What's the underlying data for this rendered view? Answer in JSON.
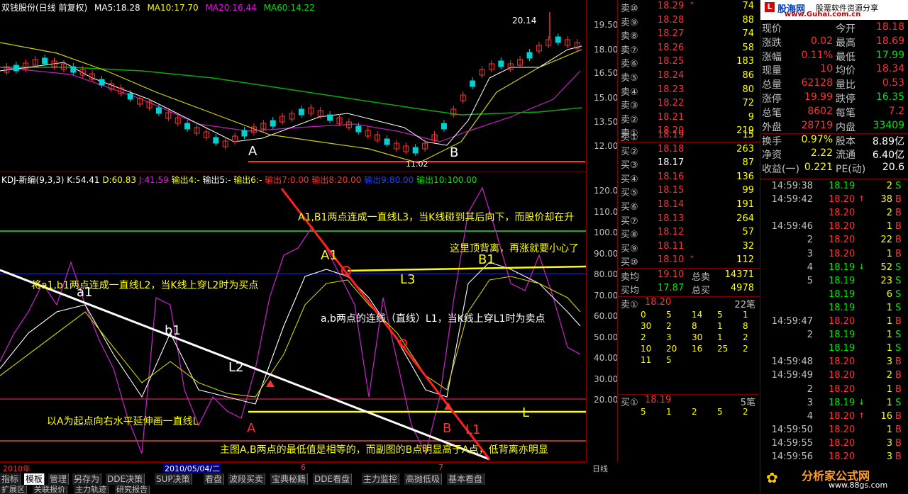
{
  "chart": {
    "header": {
      "title": "双钱股份(日线 前复权)",
      "ma5": "MA5:18.28",
      "ma10": "MA10:17.70",
      "ma20": "MA20:16.44",
      "ma60": "MA60:14.22"
    },
    "price_axis": [
      "19.50",
      "18.00",
      "16.50",
      "15.00",
      "13.50",
      "12.00"
    ],
    "kdj_axis": [
      "120.0",
      "110.0",
      "100.0",
      "90.00",
      "80.00",
      "70.00",
      "60.00",
      "50.00",
      "40.00",
      "30.00",
      "20.00"
    ],
    "peak_label": "20.14",
    "trough_label": "11.02",
    "kdj_header": {
      "name": "KDJ-新编(9,3,3)",
      "k": "K:54.41",
      "d": "D:60.83",
      "j": "J:41.59",
      "out4": "输出4:-",
      "out5": "输出5:-",
      "out6": "输出6:-",
      "out7": "输出7:0.00",
      "out8": "输出8:20.00",
      "out9": "输出9:80.00",
      "out10": "输出10:100.00"
    },
    "annotations": {
      "a1b1_line": "A1,B1两点连成一直线L3，当K线碰到其后向下，而股价却在升",
      "top_divergence": "这里顶背离，再涨就要小心了",
      "l2_buy": "将a1,b1两点连成一直线L2，当K线上穿L2时为买点",
      "l1_sell": "a,b两点的连线（直线）L1，当K线上穿L1时为卖点",
      "horizontal_l": "以A为起点向右水平延伸画一直线L",
      "bottom_note": "主图A,B两点的最低值是相等的，而副图的B点明显高于A点，低背离亦明显"
    },
    "point_labels": {
      "A": "A",
      "B": "B",
      "A1": "A1",
      "B1": "B1",
      "a1": "a1",
      "b1": "b1",
      "L2": "L2",
      "L3": "L3",
      "L": "L",
      "L1": "L1",
      "a_small": "a",
      "b_small": "b"
    },
    "date_axis": {
      "year": "2010年",
      "cursor_date": "2010/05/04/二",
      "m6": "6",
      "m7": "7",
      "period": "日线"
    }
  },
  "bottom_tabs": [
    "指标",
    "模板",
    "管理",
    "另存为",
    "DDE决策",
    "SUP决策",
    "看盘",
    "波段买卖",
    "宝典秘籍",
    "DDE看盘",
    "主力监控",
    "高抛低吸",
    "基本看盘"
  ],
  "bottom_tabs2": [
    "扩展区",
    "关联报价",
    "主力轨迹",
    "研究报告"
  ],
  "orderbook": {
    "sells": [
      {
        "label": "卖⑩",
        "price": "18.29",
        "vol": "74",
        "mark": "*"
      },
      {
        "label": "卖⑨",
        "price": "18.28",
        "vol": "88",
        "mark": ""
      },
      {
        "label": "卖⑧",
        "price": "18.27",
        "vol": "74",
        "mark": ""
      },
      {
        "label": "卖⑦",
        "price": "18.26",
        "vol": "58",
        "mark": ""
      },
      {
        "label": "卖⑥",
        "price": "18.25",
        "vol": "183",
        "mark": ""
      },
      {
        "label": "卖⑤",
        "price": "18.24",
        "vol": "86",
        "mark": ""
      },
      {
        "label": "卖④",
        "price": "18.23",
        "vol": "80",
        "mark": ""
      },
      {
        "label": "卖③",
        "price": "18.22",
        "vol": "72",
        "mark": ""
      },
      {
        "label": "卖②",
        "price": "18.21",
        "vol": "9",
        "mark": ""
      },
      {
        "label": "卖①",
        "price": "18.20",
        "vol": "219",
        "mark": ""
      }
    ],
    "buys": [
      {
        "label": "买①",
        "price": "18.19",
        "vol": "15",
        "mark": ""
      },
      {
        "label": "买②",
        "price": "18.18",
        "vol": "263",
        "mark": ""
      },
      {
        "label": "买③",
        "price": "18.17",
        "vol": "87",
        "mark": ""
      },
      {
        "label": "买④",
        "price": "18.16",
        "vol": "136",
        "mark": ""
      },
      {
        "label": "买⑤",
        "price": "18.15",
        "vol": "99",
        "mark": ""
      },
      {
        "label": "买⑥",
        "price": "18.14",
        "vol": "191",
        "mark": ""
      },
      {
        "label": "买⑦",
        "price": "18.13",
        "vol": "264",
        "mark": ""
      },
      {
        "label": "买⑧",
        "price": "18.12",
        "vol": "57",
        "mark": ""
      },
      {
        "label": "买⑨",
        "price": "18.11",
        "vol": "32",
        "mark": ""
      },
      {
        "label": "买⑩",
        "price": "18.10",
        "vol": "112",
        "mark": "*"
      }
    ],
    "avg": [
      {
        "label": "卖均",
        "price": "19.10",
        "k2": "总卖",
        "v": "14371"
      },
      {
        "label": "买均",
        "price": "17.87",
        "k2": "总买",
        "v": "4978"
      }
    ],
    "sell1_queue": {
      "label": "卖①",
      "price": "18.20",
      "count": "22笔",
      "rows": [
        [
          "0",
          "5",
          "14",
          "5",
          "1"
        ],
        [
          "30",
          "2",
          "8",
          "1",
          "8"
        ],
        [
          "2",
          "3",
          "30",
          "1",
          "2"
        ],
        [
          "10",
          "20",
          "16",
          "25",
          "2"
        ],
        [
          "11",
          "5",
          "",
          "",
          ""
        ]
      ]
    },
    "buy1_queue": {
      "label": "买①",
      "price": "18.19",
      "count": "5笔",
      "rows": [
        [
          "5",
          "1",
          "2",
          "5",
          "2"
        ]
      ]
    }
  },
  "quote": {
    "logo": "股海网",
    "logo_sub": "股票软件资源分享",
    "site": "www.Guhai.com.cn",
    "rows": [
      {
        "k1": "现价",
        "v1": "",
        "k2": "今开",
        "v2": "18.18"
      },
      {
        "k1": "涨跌",
        "v1": "0.02",
        "k2": "最高",
        "v2": "18.69"
      },
      {
        "k1": "涨幅",
        "v1": "0.11%",
        "k2": "最低",
        "v2": "17.99"
      },
      {
        "k1": "现量",
        "v1": "10",
        "k2": "均价",
        "v2": "18.34"
      },
      {
        "k1": "总量",
        "v1": "62128",
        "k2": "量比",
        "v2": "0.53"
      },
      {
        "k1": "涨停",
        "v1": "19.99",
        "k2": "跌停",
        "v2": "16.35"
      },
      {
        "k1": "总笔",
        "v1": "8602",
        "k2": "每笔",
        "v2": "7.2"
      },
      {
        "k1": "外盘",
        "v1": "28719",
        "k2": "内盘",
        "v2": "33409"
      },
      {
        "k1": "换手",
        "v1": "0.97%",
        "k2": "股本",
        "v2": "8.89亿"
      },
      {
        "k1": "净资",
        "v1": "2.22",
        "k2": "流通",
        "v2": "6.40亿"
      },
      {
        "k1": "收益(一)",
        "v1": "0.221",
        "k2": "PE(动)",
        "v2": "20.6"
      }
    ],
    "ticks": [
      {
        "t": "14:59:38",
        "p": "18.19",
        "v": "2",
        "s": "S",
        "arrow": ""
      },
      {
        "t": "14:59:42",
        "p": "18.20",
        "v": "38",
        "s": "B",
        "arrow": "↑"
      },
      {
        "t": "",
        "p": "18.20",
        "v": "2",
        "s": "B",
        "arrow": ""
      },
      {
        "t": "14:59:46",
        "p": "18.20",
        "v": "1",
        "s": "B",
        "arrow": ""
      },
      {
        "t": "2",
        "p": "18.20",
        "v": "22",
        "s": "B",
        "arrow": ""
      },
      {
        "t": "3",
        "p": "18.20",
        "v": "1",
        "s": "B",
        "arrow": ""
      },
      {
        "t": "4",
        "p": "18.19",
        "v": "52",
        "s": "S",
        "arrow": "↓"
      },
      {
        "t": "5",
        "p": "18.19",
        "v": "23",
        "s": "S",
        "arrow": ""
      },
      {
        "t": "",
        "p": "18.19",
        "v": "6",
        "s": "S",
        "arrow": ""
      },
      {
        "t": "",
        "p": "18.19",
        "v": "1",
        "s": "S",
        "arrow": ""
      },
      {
        "t": "14:59:47",
        "p": "18.20",
        "v": "1",
        "s": "B",
        "arrow": ""
      },
      {
        "t": "2",
        "p": "18.19",
        "v": "1",
        "s": "S",
        "arrow": ""
      },
      {
        "t": "",
        "p": "18.19",
        "v": "1",
        "s": "S",
        "arrow": ""
      },
      {
        "t": "14:59:48",
        "p": "18.20",
        "v": "3",
        "s": "B",
        "arrow": ""
      },
      {
        "t": "14:59:49",
        "p": "18.20",
        "v": "2",
        "s": "B",
        "arrow": ""
      },
      {
        "t": "2",
        "p": "18.20",
        "v": "1",
        "s": "B",
        "arrow": ""
      },
      {
        "t": "3",
        "p": "18.19",
        "v": "1",
        "s": "S",
        "arrow": "↓"
      },
      {
        "t": "4",
        "p": "18.20",
        "v": "16",
        "s": "B",
        "arrow": "↑"
      },
      {
        "t": "14:59:50",
        "p": "18.20",
        "v": "1",
        "s": "B",
        "arrow": ""
      },
      {
        "t": "14:59:55",
        "p": "18.20",
        "v": "3",
        "s": "B",
        "arrow": ""
      },
      {
        "t": "14:59:56",
        "p": "18.20",
        "v": "3",
        "s": "B",
        "arrow": ""
      }
    ],
    "footer_logo": "分析家公式网",
    "footer_site": "www.88gs.com"
  },
  "colors": {
    "up": "#ff3232",
    "down": "#00e600",
    "bg": "#000000",
    "axis": "#800000"
  }
}
